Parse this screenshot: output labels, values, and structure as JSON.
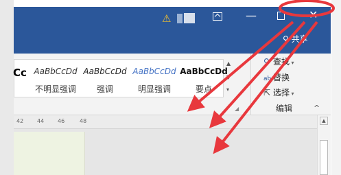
{
  "window": {
    "warning_icon": "warning-icon",
    "share_label": "共享",
    "controls": [
      "ribbon-display-options-icon",
      "minimize-icon",
      "maximize-icon",
      "close-icon"
    ]
  },
  "ribbon": {
    "styles": [
      {
        "sample": "Cc",
        "label": ""
      },
      {
        "sample": "AaBbCcDd",
        "label": "不明显强调"
      },
      {
        "sample": "AaBbCcDd",
        "label": "强调"
      },
      {
        "sample": "AaBbCcDd",
        "label": "明显强调"
      },
      {
        "sample": "AaBbCcDd",
        "label": "要点"
      }
    ],
    "editing": {
      "find": "查找",
      "replace": "替换",
      "select": "选择",
      "group_label": "编辑"
    }
  },
  "ruler": {
    "ticks": [
      "42",
      "44",
      "46",
      "48"
    ]
  },
  "colors": {
    "title_bar": "#2b579a",
    "annotation": "#e8383d"
  }
}
